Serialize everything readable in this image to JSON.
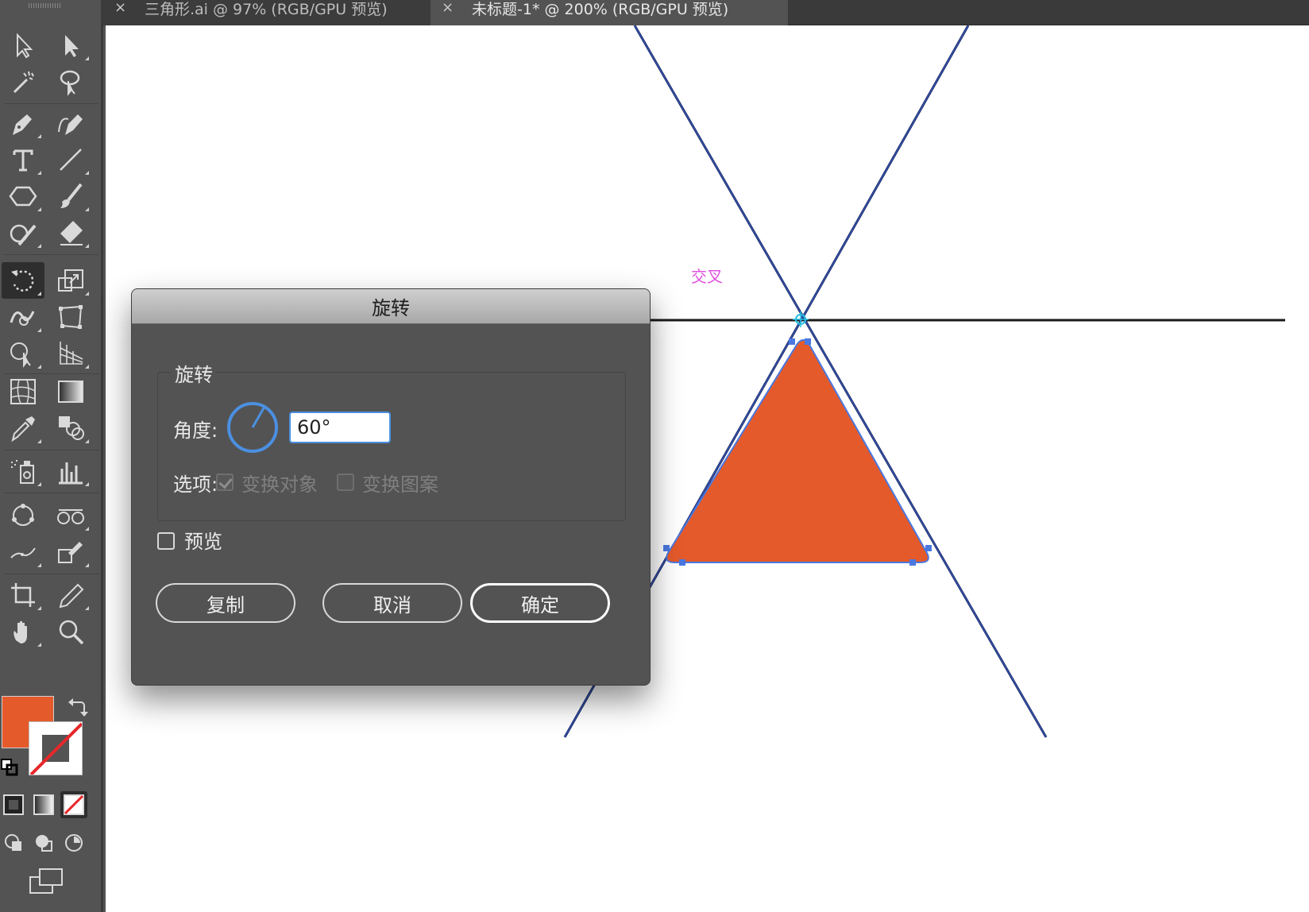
{
  "tabs": [
    {
      "title": "三角形.ai @ 97% (RGB/GPU 预览)",
      "close": "×",
      "active": false
    },
    {
      "title": "未标题-1* @ 200% (RGB/GPU 预览)",
      "close": "×",
      "active": true
    }
  ],
  "toolbar": {
    "tools": [
      {
        "name": "selection-tool",
        "icon": "selection-arrow-icon"
      },
      {
        "name": "direct-selection-tool",
        "icon": "direct-selection-icon"
      },
      {
        "name": "magic-wand-tool",
        "icon": "magic-wand-icon"
      },
      {
        "name": "lasso-tool",
        "icon": "lasso-icon"
      },
      {
        "name": "pen-tool",
        "icon": "pen-icon"
      },
      {
        "name": "curvature-tool",
        "icon": "curvature-icon"
      },
      {
        "name": "type-tool",
        "icon": "type-icon"
      },
      {
        "name": "line-segment-tool",
        "icon": "line-icon"
      },
      {
        "name": "polygon-tool",
        "icon": "polygon-icon"
      },
      {
        "name": "paintbrush-tool",
        "icon": "paintbrush-icon"
      },
      {
        "name": "shaper-tool",
        "icon": "shaper-icon"
      },
      {
        "name": "eraser-tool",
        "icon": "eraser-icon"
      },
      {
        "name": "rotate-tool",
        "icon": "rotate-icon",
        "active": true
      },
      {
        "name": "scale-tool",
        "icon": "scale-icon"
      },
      {
        "name": "warp-tool",
        "icon": "warp-icon"
      },
      {
        "name": "free-transform-tool",
        "icon": "free-transform-icon"
      },
      {
        "name": "shape-builder-tool",
        "icon": "shape-builder-icon"
      },
      {
        "name": "perspective-grid-tool",
        "icon": "perspective-grid-icon"
      },
      {
        "name": "mesh-tool",
        "icon": "mesh-icon"
      },
      {
        "name": "gradient-tool",
        "icon": "gradient-icon"
      },
      {
        "name": "eyedropper-tool",
        "icon": "eyedropper-icon"
      },
      {
        "name": "blend-tool",
        "icon": "blend-icon"
      },
      {
        "name": "symbol-sprayer-tool",
        "icon": "symbol-sprayer-icon"
      },
      {
        "name": "column-graph-tool",
        "icon": "column-graph-icon"
      },
      {
        "name": "puppet-warp-tool",
        "icon": "puppet-warp-icon"
      },
      {
        "name": "width-tool",
        "icon": "width-icon"
      },
      {
        "name": "smooth-tool",
        "icon": "smooth-icon"
      },
      {
        "name": "live-paint-tool",
        "icon": "live-paint-icon"
      },
      {
        "name": "artboard-tool",
        "icon": "artboard-icon"
      },
      {
        "name": "pencil-tool",
        "icon": "pencil-icon"
      },
      {
        "name": "hand-tool",
        "icon": "hand-icon"
      },
      {
        "name": "zoom-tool",
        "icon": "zoom-icon"
      }
    ],
    "fill_color": "#e55a2b",
    "stroke_color": "none"
  },
  "canvas": {
    "triangle_fill": "#e55a2b",
    "guide_color": "#1c2a6b",
    "selection_color": "#4a78e0",
    "smart_guide_label": "交叉",
    "smart_guide_color": "#e052e0"
  },
  "dialog": {
    "title": "旋转",
    "group_label": "旋转",
    "angle_label": "角度:",
    "angle_value": "60°",
    "options_label": "选项:",
    "transform_objects_label": "变换对象",
    "transform_objects_checked": true,
    "transform_patterns_label": "变换图案",
    "transform_patterns_checked": false,
    "preview_label": "预览",
    "preview_checked": false,
    "copy_button": "复制",
    "cancel_button": "取消",
    "ok_button": "确定",
    "accent_color": "#4b8fe0"
  }
}
